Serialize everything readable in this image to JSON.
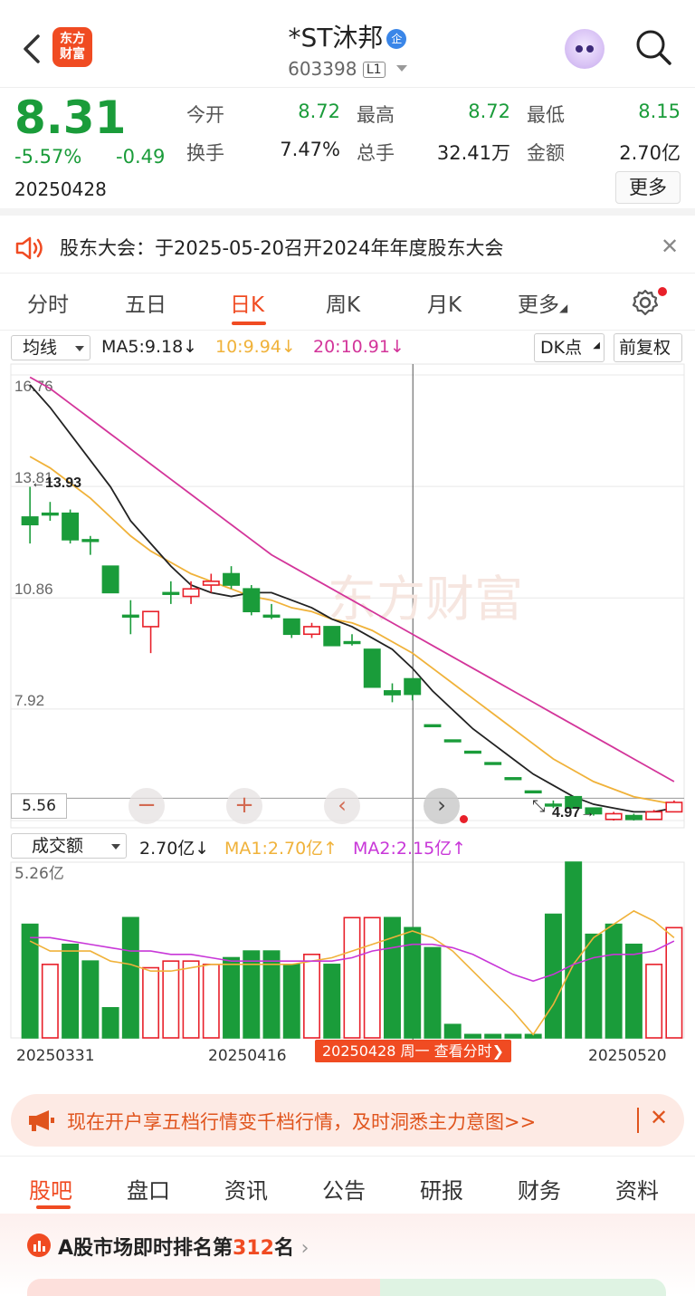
{
  "header": {
    "title": "*ST沐邦",
    "badge": "企",
    "code": "603398",
    "level": "L1",
    "logo_line1": "东方",
    "logo_line2": "财富"
  },
  "quote": {
    "price": "8.31",
    "change_pct": "-5.57%",
    "change": "-0.49",
    "date": "20250428",
    "fields": [
      {
        "label": "今开",
        "value": "8.72"
      },
      {
        "label": "最高",
        "value": "8.72"
      },
      {
        "label": "最低",
        "value": "8.15"
      },
      {
        "label": "换手",
        "value": "7.47%"
      },
      {
        "label": "总手",
        "value": "32.41万"
      },
      {
        "label": "金额",
        "value": "2.70亿"
      }
    ],
    "more": "更多",
    "colors": {
      "down": "#1a9c3a",
      "up": "#e8202a",
      "accent": "#f04b22"
    }
  },
  "notice": {
    "text": "股东大会：于2025-05-20召开2024年年度股东大会",
    "icon": "speaker-icon"
  },
  "tabs": [
    "分时",
    "五日",
    "日K",
    "周K",
    "月K",
    "更多"
  ],
  "active_tab": "日K",
  "indicators": {
    "main_select": "均线",
    "ma5": "MA5:9.18↓",
    "ma10": "10:9.94↓",
    "ma20": "20:10.91↓",
    "dk": "DK点",
    "fq": "前复权",
    "vol_select": "成交额",
    "vol_value": "2.70亿↓",
    "vol_ma1": "MA1:2.70亿↑",
    "vol_ma2": "MA2:2.15亿↑",
    "vol_max": "5.26亿"
  },
  "chart_data": {
    "type": "candlestick",
    "y_ticks": [
      "16.76",
      "13.81",
      "10.86",
      "7.92",
      "4.97"
    ],
    "ylim": [
      4.97,
      16.76
    ],
    "price_label_left": "5.56",
    "max_label": "13.93",
    "min_label": "4.97",
    "candles": [
      {
        "o": 13.0,
        "c": 12.8,
        "h": 13.8,
        "l": 12.3
      },
      {
        "o": 13.1,
        "c": 13.1,
        "h": 13.4,
        "l": 12.9
      },
      {
        "o": 13.1,
        "c": 12.4,
        "h": 13.2,
        "l": 12.3
      },
      {
        "o": 12.4,
        "c": 12.4,
        "h": 12.5,
        "l": 12.0
      },
      {
        "o": 11.7,
        "c": 11.0,
        "h": 11.7,
        "l": 11.0
      },
      {
        "o": 10.4,
        "c": 10.4,
        "h": 10.8,
        "l": 9.9
      },
      {
        "o": 10.1,
        "c": 10.5,
        "h": 10.5,
        "l": 9.4
      },
      {
        "o": 11.0,
        "c": 11.0,
        "h": 11.3,
        "l": 10.7
      },
      {
        "o": 10.9,
        "c": 11.1,
        "h": 11.3,
        "l": 10.7
      },
      {
        "o": 11.2,
        "c": 11.3,
        "h": 11.5,
        "l": 11.0
      },
      {
        "o": 11.5,
        "c": 11.2,
        "h": 11.7,
        "l": 11.1
      },
      {
        "o": 11.1,
        "c": 10.5,
        "h": 11.2,
        "l": 10.4
      },
      {
        "o": 10.4,
        "c": 10.4,
        "h": 10.7,
        "l": 10.3
      },
      {
        "o": 10.3,
        "c": 9.9,
        "h": 10.3,
        "l": 9.8
      },
      {
        "o": 9.9,
        "c": 10.1,
        "h": 10.2,
        "l": 9.8
      },
      {
        "o": 10.1,
        "c": 9.6,
        "h": 10.1,
        "l": 9.6
      },
      {
        "o": 9.7,
        "c": 9.7,
        "h": 9.9,
        "l": 9.6
      },
      {
        "o": 9.5,
        "c": 8.5,
        "h": 9.5,
        "l": 8.5
      },
      {
        "o": 8.4,
        "c": 8.3,
        "h": 8.6,
        "l": 8.1
      },
      {
        "o": 8.72,
        "c": 8.31,
        "h": 8.72,
        "l": 8.15
      },
      {
        "o": 7.5,
        "c": 7.5,
        "h": 7.5,
        "l": 7.5
      },
      {
        "o": 7.1,
        "c": 7.1,
        "h": 7.1,
        "l": 7.1
      },
      {
        "o": 6.8,
        "c": 6.8,
        "h": 6.8,
        "l": 6.8
      },
      {
        "o": 6.5,
        "c": 6.5,
        "h": 6.5,
        "l": 6.5
      },
      {
        "o": 6.1,
        "c": 6.1,
        "h": 6.1,
        "l": 6.1
      },
      {
        "o": 5.75,
        "c": 5.75,
        "h": 5.75,
        "l": 5.75
      },
      {
        "o": 5.4,
        "c": 5.4,
        "h": 5.5,
        "l": 5.3
      },
      {
        "o": 5.6,
        "c": 5.3,
        "h": 5.6,
        "l": 5.3
      },
      {
        "o": 5.3,
        "c": 5.15,
        "h": 5.3,
        "l": 5.1
      },
      {
        "o": 5.0,
        "c": 5.15,
        "h": 5.2,
        "l": 4.97
      },
      {
        "o": 5.1,
        "c": 5.0,
        "h": 5.15,
        "l": 4.97
      },
      {
        "o": 5.0,
        "c": 5.2,
        "h": 5.25,
        "l": 5.0
      },
      {
        "o": 5.2,
        "c": 5.45,
        "h": 5.5,
        "l": 5.2
      }
    ],
    "ma5": [
      16.5,
      15.9,
      15.2,
      14.5,
      13.8,
      12.9,
      12.3,
      11.7,
      11.2,
      11.0,
      10.9,
      11.0,
      11.0,
      10.8,
      10.6,
      10.3,
      10.1,
      9.8,
      9.5,
      9.0,
      8.4,
      7.9,
      7.4,
      7.0,
      6.6,
      6.2,
      5.9,
      5.6,
      5.4,
      5.3,
      5.2,
      5.2,
      5.3
    ],
    "ma10": [
      14.6,
      14.3,
      13.9,
      13.5,
      13.0,
      12.5,
      12.1,
      11.8,
      11.5,
      11.3,
      11.1,
      10.9,
      10.8,
      10.6,
      10.5,
      10.3,
      10.2,
      10.0,
      9.7,
      9.4,
      9.0,
      8.6,
      8.2,
      7.8,
      7.4,
      7.0,
      6.6,
      6.3,
      6.0,
      5.8,
      5.6,
      5.5,
      5.4
    ],
    "ma20": [
      16.7,
      16.4,
      16.0,
      15.6,
      15.2,
      14.8,
      14.4,
      14.0,
      13.6,
      13.2,
      12.8,
      12.4,
      12.0,
      11.7,
      11.4,
      11.1,
      10.8,
      10.5,
      10.2,
      9.9,
      9.6,
      9.3,
      9.0,
      8.7,
      8.4,
      8.1,
      7.8,
      7.5,
      7.2,
      6.9,
      6.6,
      6.3,
      6.0
    ],
    "volume": [
      3.4,
      2.2,
      2.8,
      2.3,
      0.9,
      3.6,
      2.1,
      2.3,
      2.3,
      2.2,
      2.4,
      2.6,
      2.6,
      2.2,
      2.5,
      2.2,
      3.6,
      3.6,
      3.6,
      3.3,
      2.7,
      0.4,
      0.1,
      0.1,
      0.1,
      0.1,
      3.7,
      5.26,
      3.1,
      3.4,
      2.8,
      2.2,
      3.3
    ],
    "volume_up": [
      false,
      true,
      false,
      false,
      false,
      false,
      true,
      true,
      true,
      true,
      false,
      false,
      false,
      false,
      true,
      false,
      true,
      true,
      false,
      false,
      false,
      false,
      false,
      false,
      false,
      false,
      false,
      false,
      false,
      false,
      false,
      true,
      true
    ],
    "vol_ma1": [
      2.9,
      2.6,
      2.6,
      2.6,
      2.3,
      2.2,
      2.0,
      2.0,
      2.1,
      2.2,
      2.2,
      2.2,
      2.2,
      2.2,
      2.3,
      2.4,
      2.6,
      2.8,
      3.0,
      3.2,
      3.0,
      2.6,
      2.0,
      1.4,
      0.8,
      0.1,
      1.0,
      2.2,
      3.0,
      3.4,
      3.8,
      3.5,
      3.0
    ],
    "vol_ma2": [
      3.0,
      3.0,
      2.9,
      2.8,
      2.7,
      2.6,
      2.6,
      2.5,
      2.5,
      2.4,
      2.3,
      2.3,
      2.3,
      2.3,
      2.3,
      2.3,
      2.4,
      2.6,
      2.7,
      2.8,
      2.8,
      2.7,
      2.5,
      2.2,
      1.9,
      1.7,
      1.9,
      2.2,
      2.4,
      2.5,
      2.5,
      2.6,
      2.9
    ],
    "x_ticks": [
      "20250331",
      "20250416",
      "20250520"
    ],
    "crosshair_label": "20250428 周一 查看分时"
  },
  "ad": {
    "text": "现在开户享五档行情变千档行情，及时洞悉主力意图>>"
  },
  "bottom_tabs": [
    "股吧",
    "盘口",
    "资讯",
    "公告",
    "研报",
    "财务",
    "资料"
  ],
  "rank": {
    "prefix": "A股市场即时排名第",
    "num": "312",
    "suffix": "名"
  }
}
